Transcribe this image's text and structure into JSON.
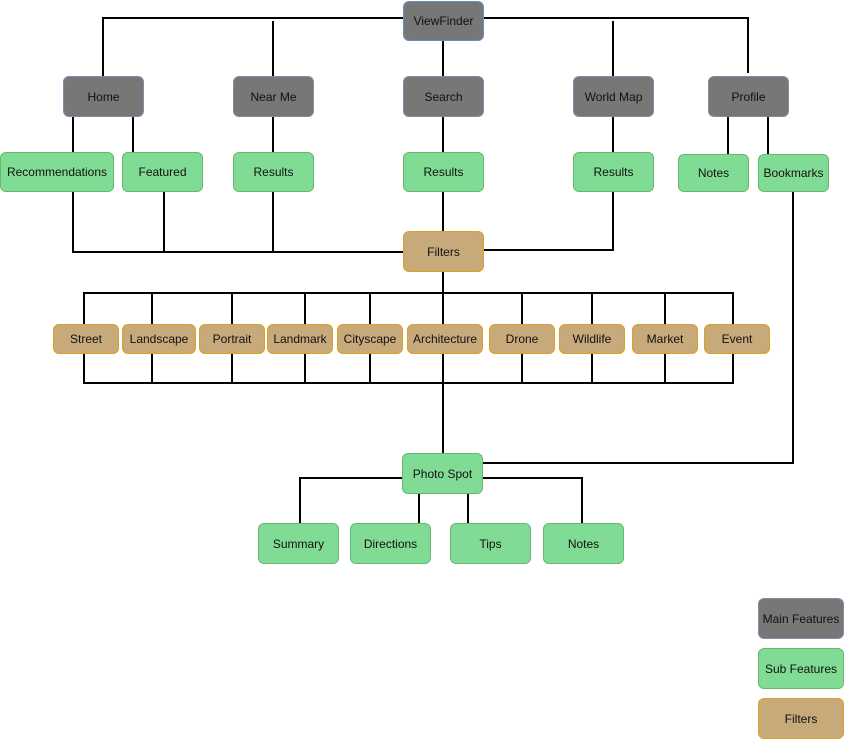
{
  "diagram": {
    "root": {
      "id": "viewfinder",
      "label": "ViewFinder",
      "kind": "root"
    },
    "main_features": [
      {
        "id": "home",
        "label": "Home"
      },
      {
        "id": "near-me",
        "label": "Near Me"
      },
      {
        "id": "search",
        "label": "Search"
      },
      {
        "id": "world-map",
        "label": "World Map"
      },
      {
        "id": "profile",
        "label": "Profile"
      }
    ],
    "sub_features": [
      {
        "id": "recommendations",
        "label": "Recommendations",
        "parent": "home"
      },
      {
        "id": "featured",
        "label": "Featured",
        "parent": "home"
      },
      {
        "id": "nearme-results",
        "label": "Results",
        "parent": "near-me"
      },
      {
        "id": "search-results",
        "label": "Results",
        "parent": "search"
      },
      {
        "id": "worldmap-results",
        "label": "Results",
        "parent": "world-map"
      },
      {
        "id": "profile-notes",
        "label": "Notes",
        "parent": "profile"
      },
      {
        "id": "bookmarks",
        "label": "Bookmarks",
        "parent": "profile"
      }
    ],
    "filters_node": {
      "id": "filters",
      "label": "Filters"
    },
    "filter_options": [
      {
        "id": "street",
        "label": "Street"
      },
      {
        "id": "landscape",
        "label": "Landscape"
      },
      {
        "id": "portrait",
        "label": "Portrait"
      },
      {
        "id": "landmark",
        "label": "Landmark"
      },
      {
        "id": "cityscape",
        "label": "Cityscape"
      },
      {
        "id": "architecture",
        "label": "Architecture"
      },
      {
        "id": "drone",
        "label": "Drone"
      },
      {
        "id": "wildlife",
        "label": "Wildlife"
      },
      {
        "id": "market",
        "label": "Market"
      },
      {
        "id": "event",
        "label": "Event"
      }
    ],
    "photo_spot": {
      "id": "photo-spot",
      "label": "Photo Spot"
    },
    "photo_spot_children": [
      {
        "id": "summary",
        "label": "Summary"
      },
      {
        "id": "directions",
        "label": "Directions"
      },
      {
        "id": "tips",
        "label": "Tips"
      },
      {
        "id": "spot-notes",
        "label": "Notes"
      }
    ],
    "edges": [
      [
        "viewfinder",
        "home"
      ],
      [
        "viewfinder",
        "near-me"
      ],
      [
        "viewfinder",
        "search"
      ],
      [
        "viewfinder",
        "world-map"
      ],
      [
        "viewfinder",
        "profile"
      ],
      [
        "home",
        "recommendations"
      ],
      [
        "home",
        "featured"
      ],
      [
        "near-me",
        "nearme-results"
      ],
      [
        "search",
        "search-results"
      ],
      [
        "world-map",
        "worldmap-results"
      ],
      [
        "profile",
        "profile-notes"
      ],
      [
        "profile",
        "bookmarks"
      ],
      [
        "recommendations",
        "filters"
      ],
      [
        "featured",
        "filters"
      ],
      [
        "nearme-results",
        "filters"
      ],
      [
        "search-results",
        "filters"
      ],
      [
        "worldmap-results",
        "filters"
      ],
      [
        "filters",
        "filter-options"
      ],
      [
        "filter-options",
        "photo-spot"
      ],
      [
        "bookmarks",
        "photo-spot"
      ],
      [
        "photo-spot",
        "summary"
      ],
      [
        "photo-spot",
        "directions"
      ],
      [
        "photo-spot",
        "tips"
      ],
      [
        "photo-spot",
        "spot-notes"
      ]
    ]
  },
  "legend": {
    "items": [
      {
        "label": "Main Features",
        "color": "#777777"
      },
      {
        "label": "Sub Features",
        "color": "#80dc94"
      },
      {
        "label": "Filters",
        "color": "#c8aa7a"
      }
    ]
  },
  "colors": {
    "main": "#777777",
    "sub": "#80dc94",
    "filter": "#c8aa7a",
    "connector": "#000000"
  }
}
